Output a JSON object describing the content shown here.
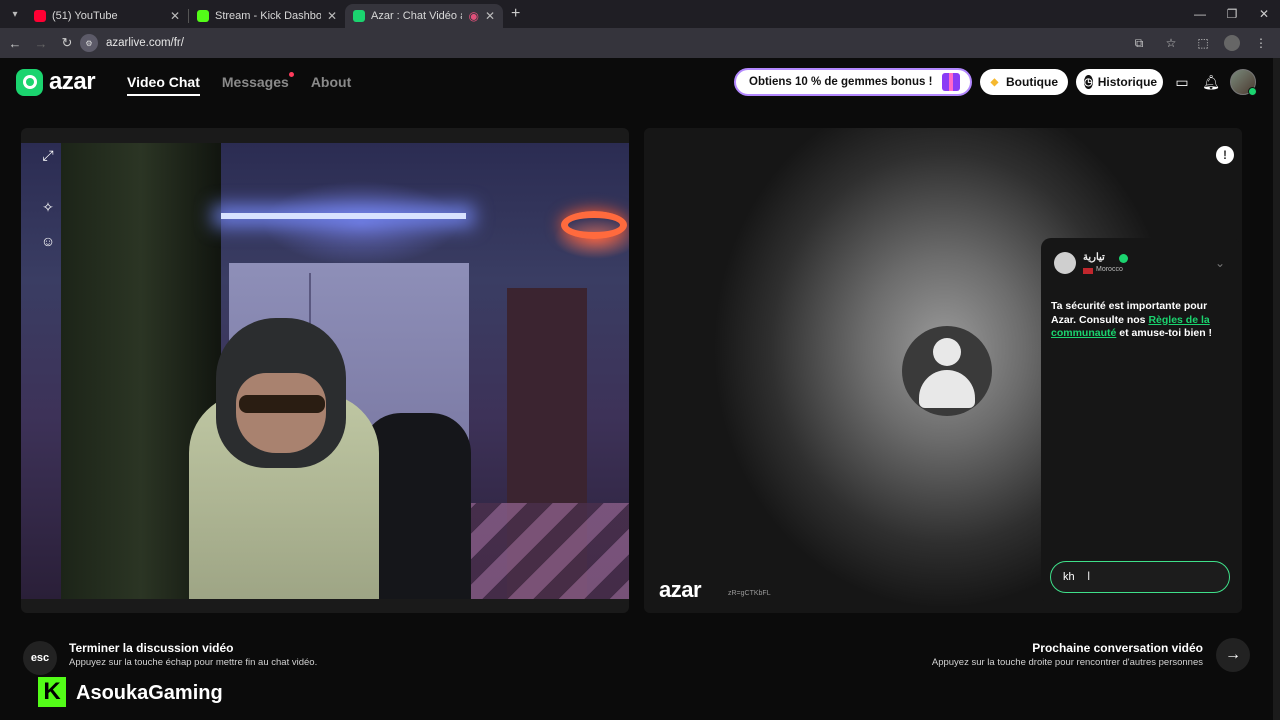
{
  "browser": {
    "tabs": [
      {
        "label": "(51) YouTube",
        "fav_color": "#ff0033",
        "active": false
      },
      {
        "label": "Stream - Kick Dashboard",
        "fav_color": "#53fc18",
        "active": false
      },
      {
        "label": "Azar : Chat Vidéo avec de",
        "fav_color": "#1bd46f",
        "active": true
      }
    ],
    "url": "azarlive.com/fr/"
  },
  "header": {
    "logo_text": "azar",
    "nav": [
      {
        "label": "Video Chat",
        "active": true
      },
      {
        "label": "Messages",
        "active": false,
        "notification_dot": true
      },
      {
        "label": "About",
        "active": false
      }
    ],
    "promo_label": "Obtiens 10 % de gemmes bonus !",
    "shop_label": "Boutique",
    "history_label": "Historique",
    "icons": [
      "gem-icon",
      "clock-icon",
      "inbox-icon",
      "bell-icon"
    ]
  },
  "peer": {
    "name": "تيارية",
    "country": "Morocco",
    "watermark": "azar",
    "session_id": "zR=gCTKbFL"
  },
  "chat": {
    "message_part1": "Ta sécurité est importante pour Azar. Consulte nos ",
    "message_link": "Règles de la communauté",
    "message_part2": " et amuse-toi bien !",
    "input_value": "kh"
  },
  "footer": {
    "esc_key": "esc",
    "end_title": "Terminer la discussion vidéo",
    "end_desc": "Appuyez sur la touche échap pour mettre fin au chat vidéo.",
    "next_title": "Prochaine conversation vidéo",
    "next_desc": "Appuyez sur la touche droite pour rencontrer d'autres personnes"
  },
  "overlay": {
    "logo_letter": "K",
    "streamer_name": "AsoukaGaming"
  },
  "colors": {
    "accent": "#1bd46f",
    "kick_green": "#53fc18"
  }
}
